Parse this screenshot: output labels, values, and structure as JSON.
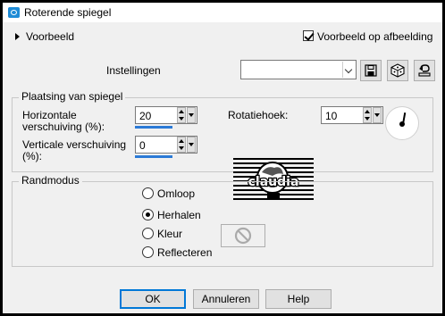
{
  "window": {
    "title": "Roterende spiegel",
    "icon": "mirror-app-icon"
  },
  "preview": {
    "expander_label": "Voorbeeld",
    "checkbox_label": "Voorbeeld op afbeelding",
    "checked": true
  },
  "settings": {
    "label": "Instellingen",
    "preset_value": "",
    "tools": [
      "save-icon",
      "randomize-dice-icon",
      "reset-icon"
    ]
  },
  "placement": {
    "title": "Plaatsing van spiegel",
    "horizontal": {
      "label_line1": "Horizontale",
      "label_line2": "verschuiving (%):",
      "value": "20",
      "level_percent": 60
    },
    "vertical": {
      "label_line1": "Verticale verschuiving",
      "label_line2": "(%):",
      "value": "0",
      "level_percent": 60
    },
    "rotation": {
      "label": "Rotatiehoek:",
      "value": "10"
    }
  },
  "watermark": {
    "text": "claudia"
  },
  "edge_mode": {
    "title": "Randmodus",
    "options": [
      {
        "label": "Omloop",
        "selected": false
      },
      {
        "label": "Herhalen",
        "selected": true
      },
      {
        "label": "Kleur",
        "selected": false
      },
      {
        "label": "Reflecteren",
        "selected": false
      }
    ],
    "color_icon": "no-color-icon"
  },
  "buttons": {
    "ok": "OK",
    "cancel": "Annuleren",
    "help": "Help"
  },
  "colors": {
    "accent": "#2b7ad6",
    "title_bg": "#ffffff",
    "dialog_bg": "#f0f0f0"
  }
}
